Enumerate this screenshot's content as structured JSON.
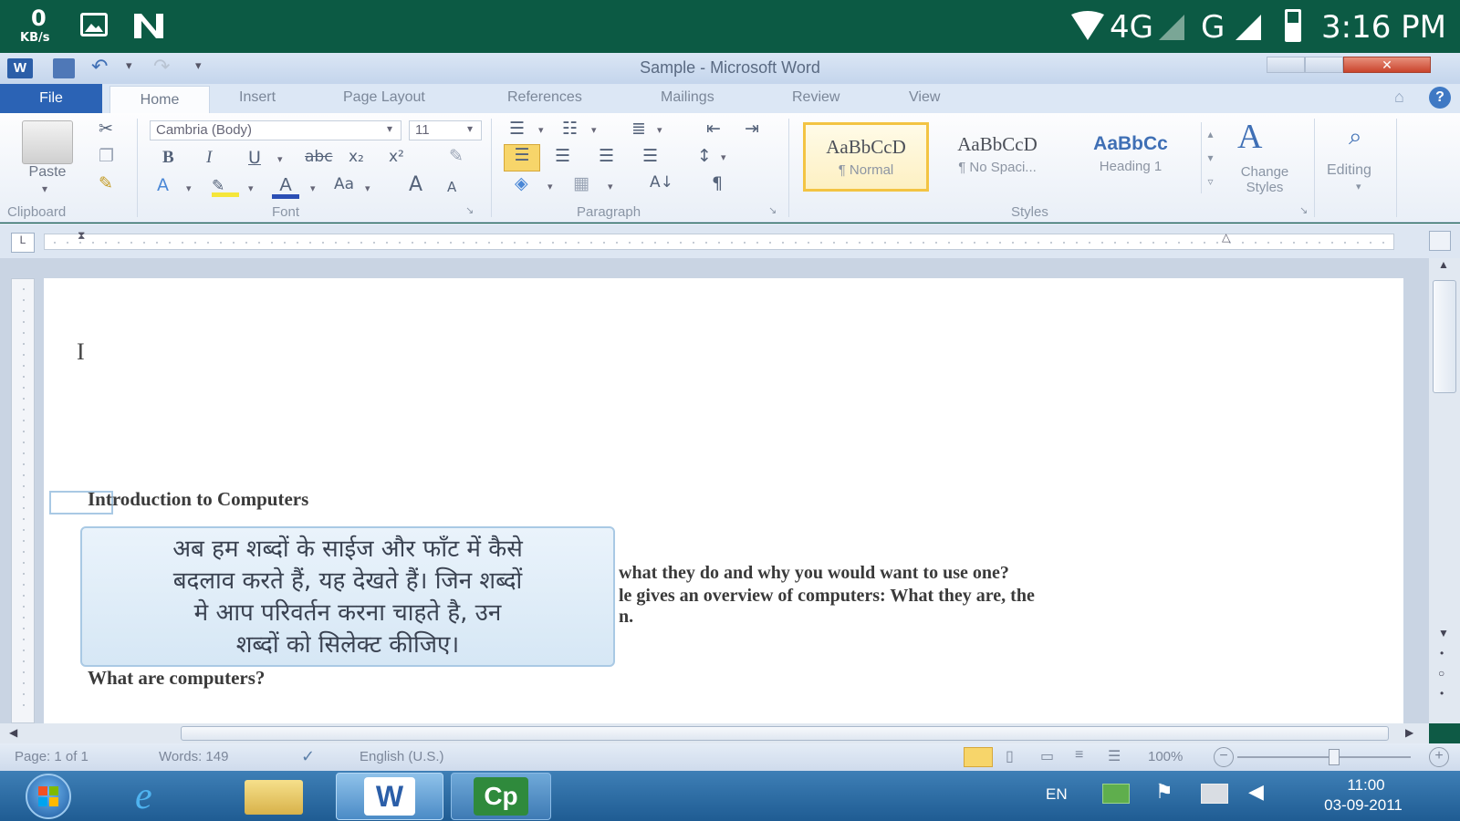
{
  "phone_status": {
    "speed_value": "0",
    "speed_unit": "KB/s",
    "network_4g": "4G",
    "network_g": "G",
    "time": "3:16 PM"
  },
  "window": {
    "title": "Sample - Microsoft Word"
  },
  "tabs": {
    "file": "File",
    "home": "Home",
    "insert": "Insert",
    "page_layout": "Page Layout",
    "references": "References",
    "mailings": "Mailings",
    "review": "Review",
    "view": "View"
  },
  "ribbon": {
    "clipboard": {
      "paste": "Paste",
      "label": "Clipboard"
    },
    "font": {
      "family": "Cambria (Body)",
      "size": "11",
      "bold": "B",
      "italic": "I",
      "underline": "U",
      "strike": "abc",
      "subscript": "x₂",
      "superscript": "x²",
      "change_case": "Aa",
      "grow": "A",
      "shrink": "A",
      "label": "Font"
    },
    "paragraph": {
      "sort": "A↓",
      "pilcrow": "¶",
      "label": "Paragraph"
    },
    "styles": {
      "items": [
        {
          "preview": "AaBbCcD",
          "name": "¶ Normal"
        },
        {
          "preview": "AaBbCcD",
          "name": "¶ No Spaci..."
        },
        {
          "preview": "AaBbCc",
          "name": "Heading 1"
        }
      ],
      "change_styles": "Change Styles",
      "label": "Styles"
    },
    "editing": {
      "label": "Editing"
    }
  },
  "document": {
    "heading": "Introduction to Computers",
    "body_line1": "what they do and why you would want to use one?",
    "body_line2": "le gives an overview of computers: What they are, the",
    "body_line3": "n.",
    "subheading": "What are computers?",
    "tooltip_lines": [
      "अब हम शब्दों के साईज और फॉंट में कैसे",
      "बदलाव करते हैं, यह देखते हैं। जिन शब्दों",
      "मे आप परिवर्तन करना चाहते है, उन",
      "शब्दों को सिलेक्ट कीजिए।"
    ]
  },
  "word_status": {
    "page": "Page: 1 of 1",
    "words": "Words: 149",
    "language": "English (U.S.)",
    "zoom": "100%"
  },
  "taskbar": {
    "word_label": "W",
    "cp_label": "Cp",
    "lang": "EN",
    "clock_time": "11:00",
    "clock_date": "03-09-2011"
  },
  "colors": {
    "phone_status_bg": "#0c5a44",
    "file_tab": "#2b63b5",
    "taskbar": "#2a6aa3",
    "normal_style_highlight": "#f3c443",
    "heading_style": "#3f6fb5"
  }
}
